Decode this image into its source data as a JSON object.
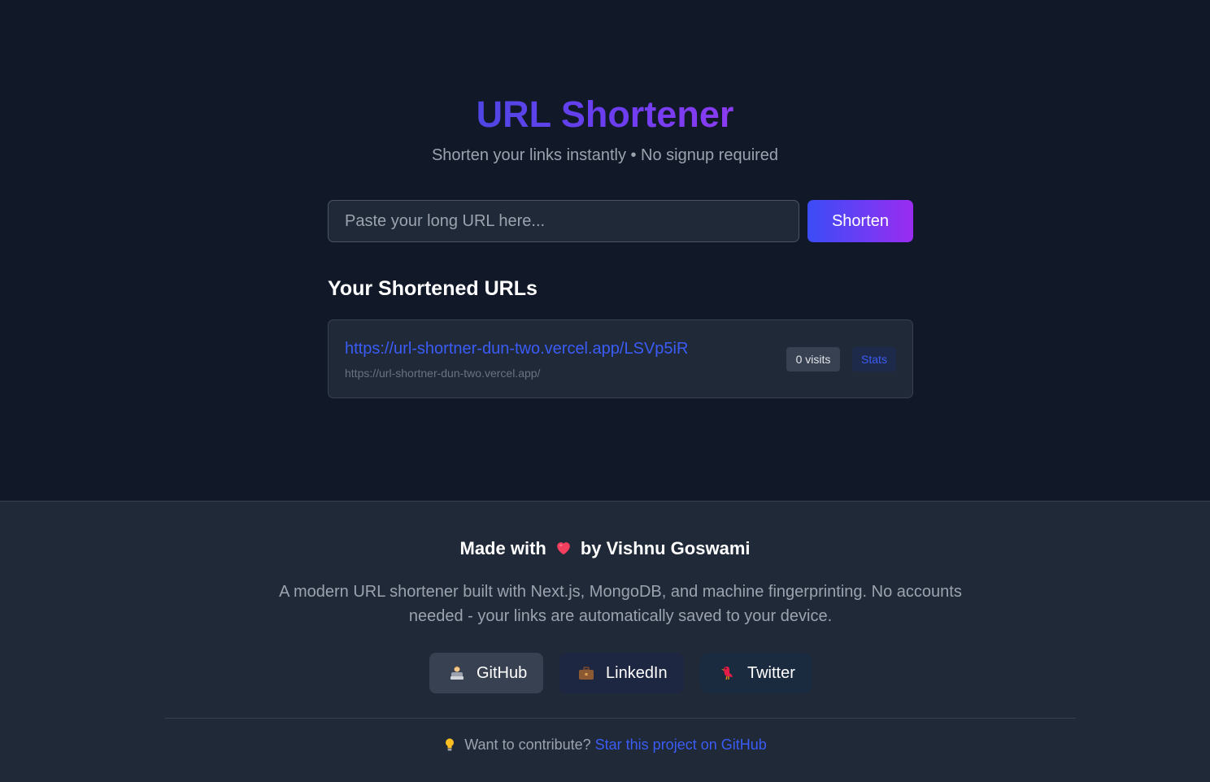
{
  "header": {
    "title": "URL Shortener",
    "subtitle": "Shorten your links instantly • No signup required"
  },
  "form": {
    "placeholder": "Paste your long URL here...",
    "value": "",
    "submit_label": "Shorten"
  },
  "shortened_list": {
    "heading": "Your Shortened URLs",
    "items": [
      {
        "short_url": "https://url-shortner-dun-two.vercel.app/LSVp5iR",
        "original_url": "https://url-shortner-dun-two.vercel.app/",
        "visits": "0 visits",
        "stats_label": "Stats"
      }
    ]
  },
  "footer": {
    "made_with_prefix": "Made with",
    "made_with_suffix": "by Vishnu Goswami",
    "heart_icon": "heart-icon",
    "description": "A modern URL shortener built with Next.js, MongoDB, and machine fingerprinting. No accounts needed - your links are automatically saved to your device.",
    "social": [
      {
        "label": "GitHub",
        "icon": "developer-icon"
      },
      {
        "label": "LinkedIn",
        "icon": "briefcase-icon"
      },
      {
        "label": "Twitter",
        "icon": "bird-icon"
      }
    ],
    "contribute_text": "Want to contribute?",
    "contribute_link": "Star this project on GitHub",
    "contribute_icon": "lightbulb-icon"
  },
  "colors": {
    "background": "#111827",
    "footer_background": "#1f2937",
    "accent": "#3b5cf6",
    "gradient_start": "#4f46e5",
    "gradient_end": "#9333ea",
    "heart": "#f43f5e"
  }
}
